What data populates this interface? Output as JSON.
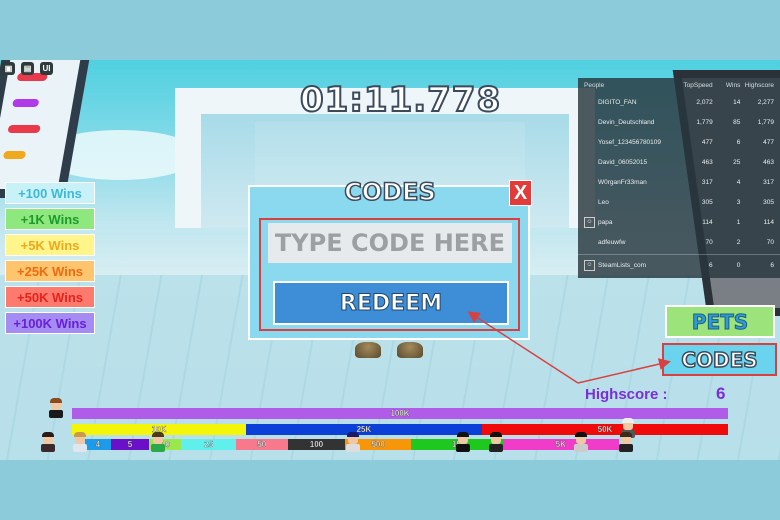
{
  "top_icons": [
    {
      "name": "backpack-icon",
      "glyph": "▣"
    },
    {
      "name": "chat-icon",
      "glyph": "▤"
    },
    {
      "name": "ui-toggle-icon",
      "glyph": "UI"
    }
  ],
  "timer": "01:11.778",
  "wins_buttons": [
    {
      "label": "+100 Wins",
      "bg": "#c8f2f8",
      "color": "#3fb8d6"
    },
    {
      "label": "+1K Wins",
      "bg": "#8ee87e",
      "color": "#1f9a2e"
    },
    {
      "label": "+5K Wins",
      "bg": "#fff58a",
      "color": "#f0a81c"
    },
    {
      "label": "+25K Wins",
      "bg": "#ffc56e",
      "color": "#f06a10"
    },
    {
      "label": "+50K Wins",
      "bg": "#ff7a6e",
      "color": "#e3241c"
    },
    {
      "label": "+100K Wins",
      "bg": "#a58cf2",
      "color": "#6a1fd8"
    }
  ],
  "codes_modal": {
    "title": "CODES",
    "close_label": "X",
    "input_placeholder": "TYPE CODE HERE",
    "input_value": "",
    "redeem_label": "REDEEM"
  },
  "leaderboard": {
    "headers": {
      "people": "People",
      "topspeed": "TopSpeed",
      "wins": "Wins",
      "highscore": "Highscore"
    },
    "rows": [
      {
        "name": "DIGITO_FAN",
        "topspeed": "2,072",
        "wins": "14",
        "highscore": "2,277",
        "has_icon": false
      },
      {
        "name": "Devin_Deutschland",
        "topspeed": "1,779",
        "wins": "85",
        "highscore": "1,779",
        "has_icon": false
      },
      {
        "name": "Yosef_123456780109",
        "topspeed": "477",
        "wins": "6",
        "highscore": "477",
        "has_icon": false
      },
      {
        "name": "David_06052015",
        "topspeed": "463",
        "wins": "25",
        "highscore": "463",
        "has_icon": false
      },
      {
        "name": "W0rganFr33man",
        "topspeed": "317",
        "wins": "4",
        "highscore": "317",
        "has_icon": false
      },
      {
        "name": "Leo",
        "topspeed": "305",
        "wins": "3",
        "highscore": "305",
        "has_icon": false
      },
      {
        "name": "papa",
        "topspeed": "114",
        "wins": "1",
        "highscore": "114",
        "has_icon": true
      },
      {
        "name": "adfeuwfw",
        "topspeed": "70",
        "wins": "2",
        "highscore": "70",
        "has_icon": false
      }
    ],
    "self_row": {
      "name": "SteamLists_com",
      "topspeed": "6",
      "wins": "0",
      "highscore": "6",
      "has_icon": true
    }
  },
  "side_buttons": {
    "pets": "PETS",
    "codes": "CODES"
  },
  "highscore": {
    "label": "Highscore :",
    "value": "6"
  },
  "progress_bars": {
    "top": [
      {
        "label": "100K",
        "color": "#b05ce8",
        "share": 1.0
      }
    ],
    "middle": [
      {
        "label": "10K",
        "color": "#f5f50a",
        "share": 0.265
      },
      {
        "label": "25K",
        "color": "#0a3fd8",
        "share": 0.36
      },
      {
        "label": "50K",
        "color": "#f00a0a",
        "share": 0.375
      }
    ],
    "bottom": [
      {
        "label": "4",
        "color": "#1e9be8",
        "share": 0.04
      },
      {
        "label": "5",
        "color": "#6a10c8",
        "share": 0.06
      },
      {
        "label": "10",
        "color": "#9be84a",
        "share": 0.05
      },
      {
        "label": "25",
        "color": "#5ff0ec",
        "share": 0.085
      },
      {
        "label": "50",
        "color": "#f8788c",
        "share": 0.08
      },
      {
        "label": "100",
        "color": "#333333",
        "share": 0.09
      },
      {
        "label": "500",
        "color": "#f8960a",
        "share": 0.102
      },
      {
        "label": "1K",
        "color": "#1ec81e",
        "share": 0.143
      },
      {
        "label": "5K",
        "color": "#f03cc8",
        "share": 0.18
      }
    ]
  }
}
